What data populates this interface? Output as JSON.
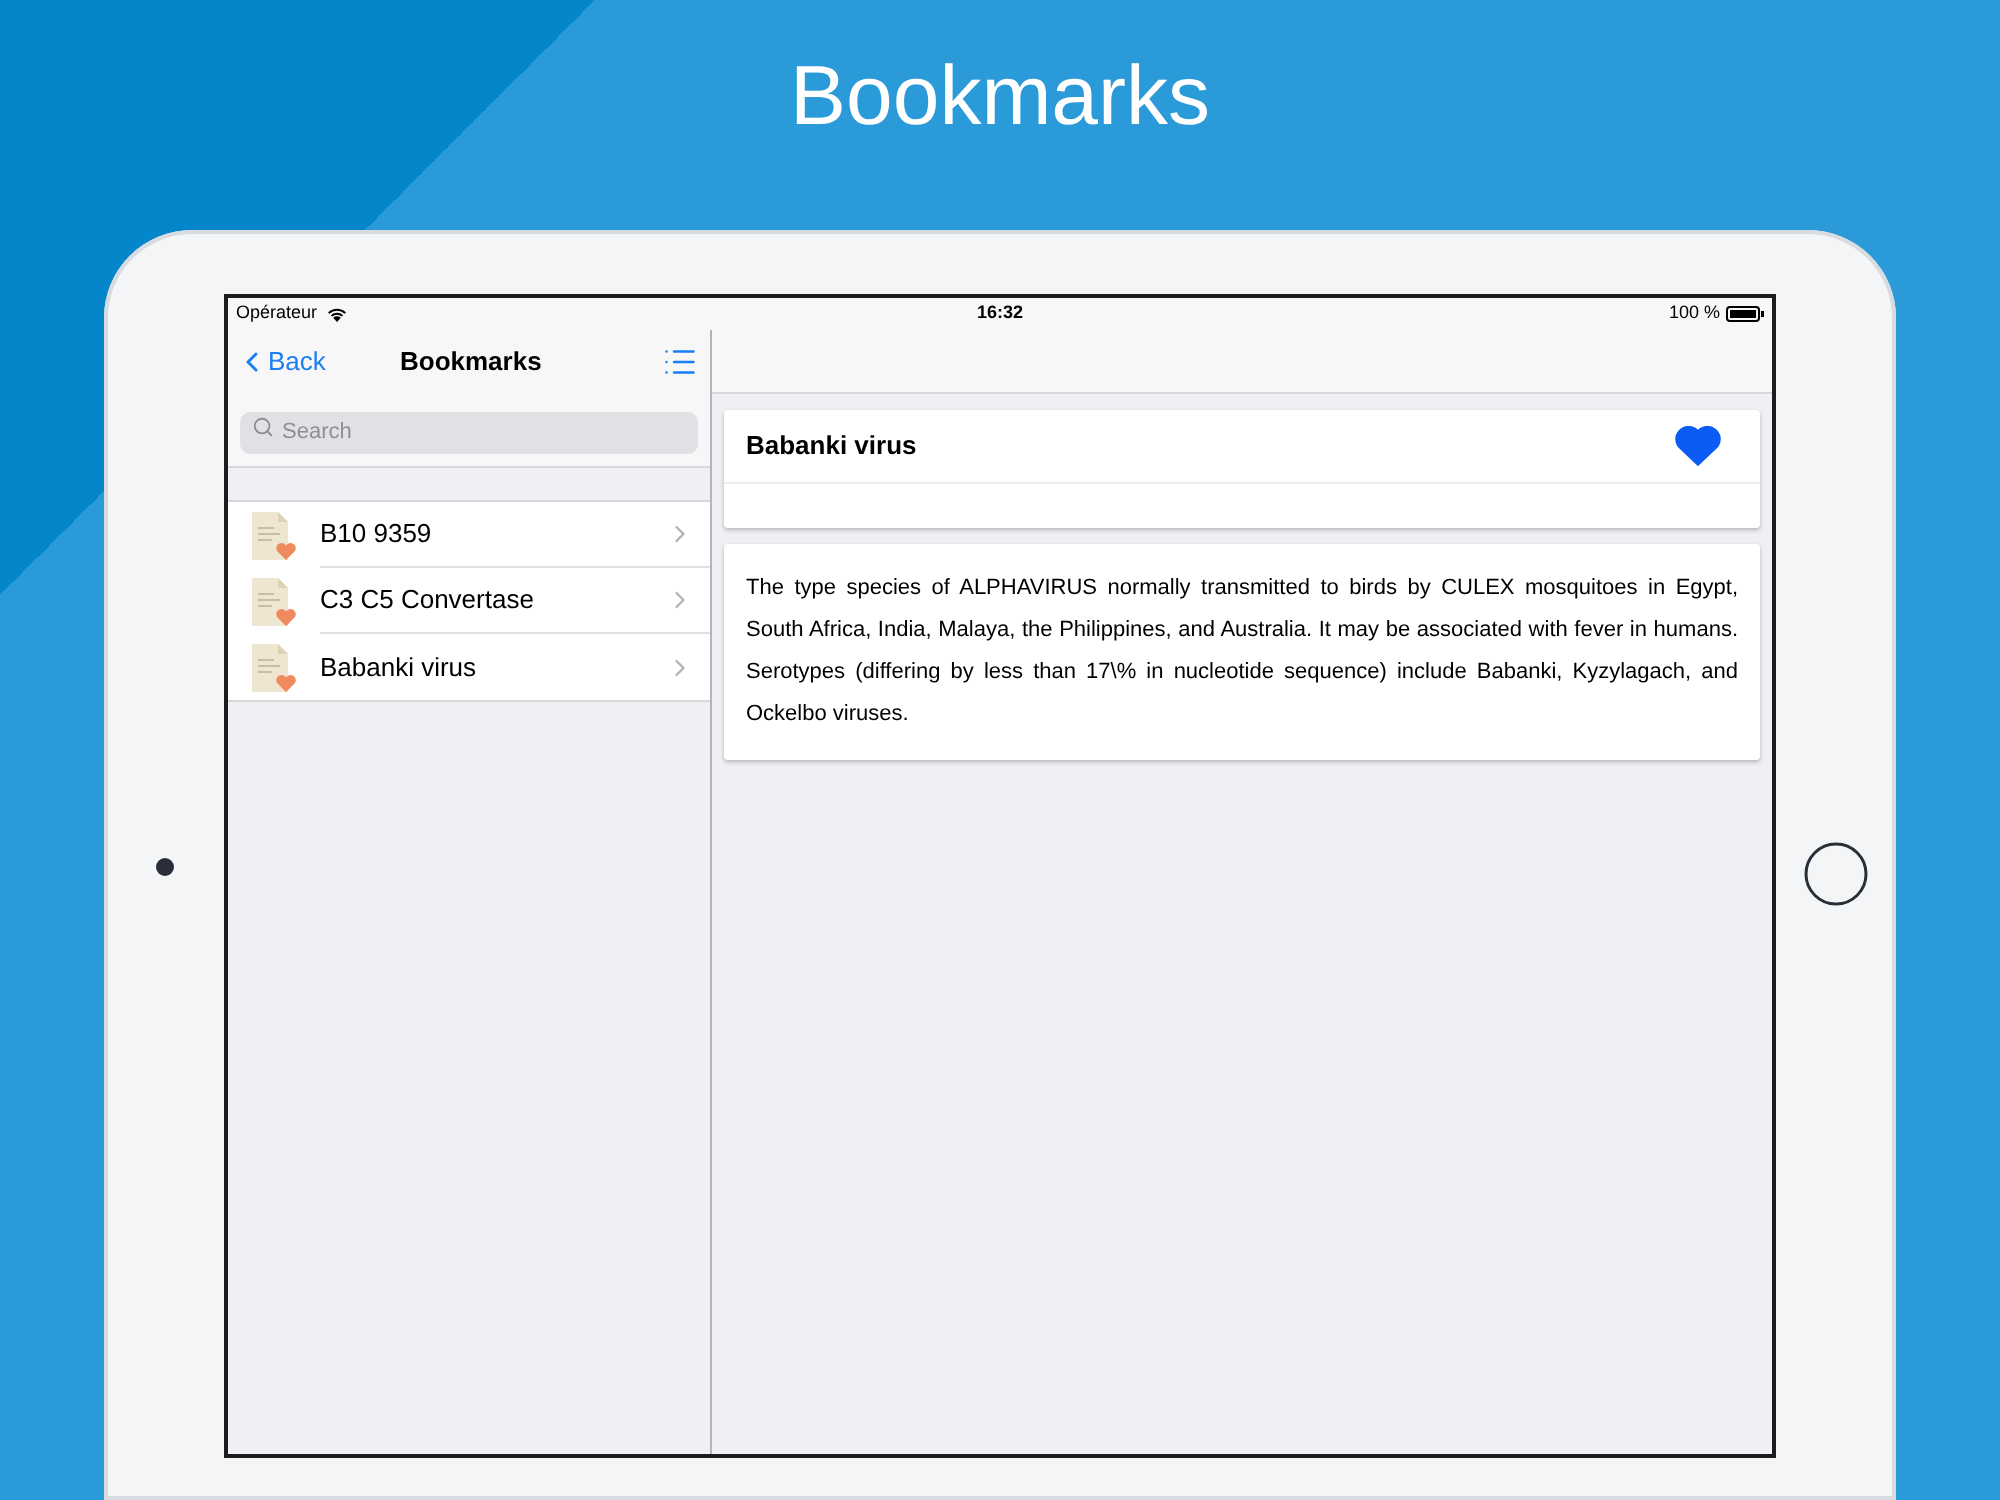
{
  "headline": "Bookmarks",
  "status_bar": {
    "carrier": "Opérateur",
    "time": "16:32",
    "battery": "100 %"
  },
  "sidebar": {
    "back": "Back",
    "title": "Bookmarks",
    "search": {
      "placeholder": "Search"
    },
    "items": [
      {
        "label": "B10 9359"
      },
      {
        "label": "C3 C5 Convertase"
      },
      {
        "label": "Babanki virus"
      }
    ]
  },
  "detail": {
    "title": "Babanki virus",
    "favorite": true,
    "body": "The type species of ALPHAVIRUS normally transmitted to birds by CULEX mosquitoes in Egypt, South Africa, India, Malaya, the Philippines, and Australia. It may be associated with fever in humans. Serotypes (differing by less than 17\\% in nucleotide sequence) include Babanki, Kyzylagach, and Ockelbo viruses."
  }
}
